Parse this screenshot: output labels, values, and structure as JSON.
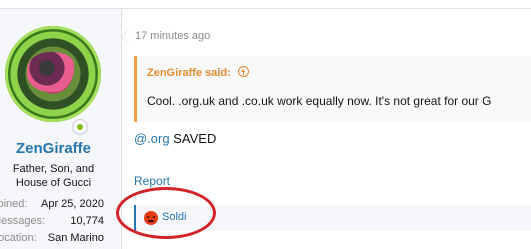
{
  "post": {
    "time": "17 minutes ago",
    "body_mention": "@.org",
    "body_rest": " SAVED",
    "report_label": "Report"
  },
  "user": {
    "name": "ZenGiraffe",
    "title_line1": "Father, Son, and",
    "title_line2": "House of Gucci",
    "stats": [
      {
        "label": "Joined:",
        "value": "Apr 25, 2020"
      },
      {
        "label": "Messages:",
        "value": "10,774"
      },
      {
        "label": "Location:",
        "value": "San Marino"
      }
    ]
  },
  "quote": {
    "author_said": "ZenGiraffe said:",
    "text": "Cool. .org.uk and .co.uk work equally now. It's not great for our G"
  },
  "reactions": {
    "user": "Soldi",
    "icon": "angry-face-icon",
    "color": "#e63a17"
  },
  "colors": {
    "link": "#2577b1",
    "quote_accent": "#e38c2f",
    "annotation": "#d3242a"
  }
}
